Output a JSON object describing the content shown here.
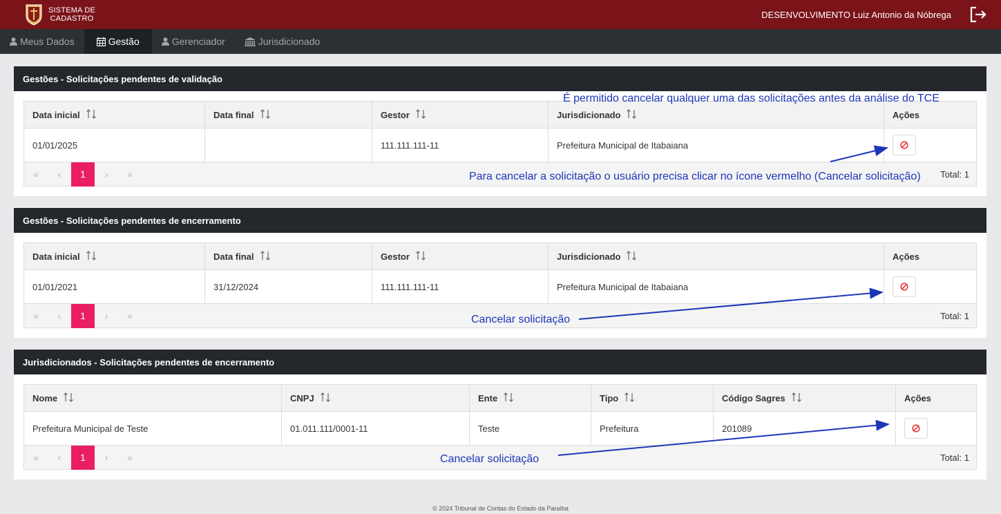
{
  "header": {
    "logo_line1": "SISTEMA DE",
    "logo_line2": "CADASTRO",
    "user_name": "DESENVOLVIMENTO Luiz Antonio da Nóbrega"
  },
  "nav": {
    "items": [
      {
        "label": "Meus Dados",
        "icon": "user-icon"
      },
      {
        "label": "Gestão",
        "icon": "calendar-icon"
      },
      {
        "label": "Gerenciador",
        "icon": "user-icon"
      },
      {
        "label": "Jurisdicionado",
        "icon": "bank-icon"
      }
    ]
  },
  "panels": [
    {
      "title": "Gestões - Solicitações pendentes de validação",
      "columns": [
        "Data inicial",
        "Data final",
        "Gestor",
        "Jurisdicionado",
        "Ações"
      ],
      "row": [
        "01/01/2025",
        "",
        "111.111.111-11",
        "Prefeitura Municipal de Itabaiana"
      ],
      "pager": {
        "first": "«",
        "prev": "‹",
        "current": "1",
        "next": "›",
        "last": "»",
        "total": "Total: 1"
      }
    },
    {
      "title": "Gestões - Solicitações pendentes de encerramento",
      "columns": [
        "Data inicial",
        "Data final",
        "Gestor",
        "Jurisdicionado",
        "Ações"
      ],
      "row": [
        "01/01/2021",
        "31/12/2024",
        "111.111.111-11",
        "Prefeitura Municipal de Itabaiana"
      ],
      "pager": {
        "first": "«",
        "prev": "‹",
        "current": "1",
        "next": "›",
        "last": "»",
        "total": "Total: 1"
      }
    },
    {
      "title": "Jurisdicionados - Solicitações pendentes de encerramento",
      "columns": [
        "Nome",
        "CNPJ",
        "Ente",
        "Tipo",
        "Código Sagres",
        "Ações"
      ],
      "row": [
        "Prefeitura Municipal de Teste",
        "01.011.111/0001-11",
        "Teste",
        "Prefeitura",
        "201089"
      ],
      "pager": {
        "first": "«",
        "prev": "‹",
        "current": "1",
        "next": "›",
        "last": "»",
        "total": "Total: 1"
      }
    }
  ],
  "annotations": {
    "note_top": "É permitido cancelar qualquer uma das solicitações antes da análise do TCE",
    "note_click": "Para cancelar a solicitação o usuário precisa clicar no ícone vermelho (Cancelar solicitação)",
    "note_cancel_2": "Cancelar solicitação",
    "note_cancel_3": "Cancelar solicitação"
  },
  "footer": {
    "text": "© 2024 Tribunal de Contas do Estado da Paraíba"
  },
  "colors": {
    "topbar": "#7a1419",
    "navbar": "#2b3035",
    "panel_header": "#24282d",
    "pager_active": "#e91e63",
    "cancel_icon": "#e53935",
    "annotation": "#1c36b8"
  }
}
